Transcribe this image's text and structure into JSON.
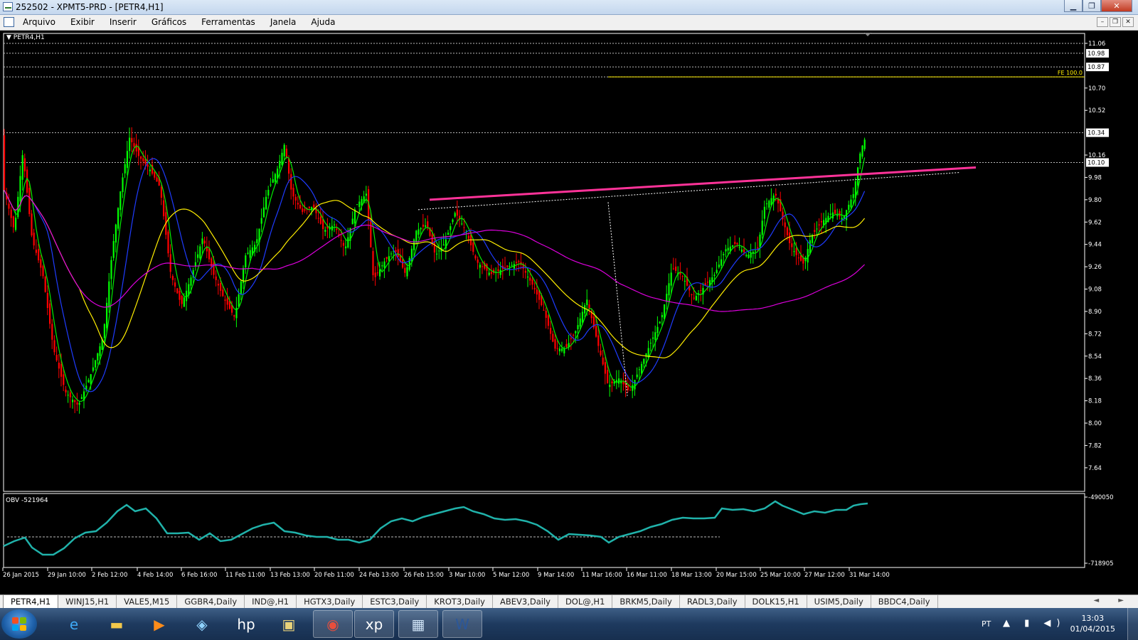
{
  "window": {
    "title": "252502 - XPMT5-PRD - [PETR4,H1]"
  },
  "window_buttons": {
    "minimize": "▁",
    "maximize": "❐",
    "close": "✕"
  },
  "mdi_buttons": {
    "minimize": "–",
    "restore": "❐",
    "close": "✕"
  },
  "menu": [
    "Arquivo",
    "Exibir",
    "Inserir",
    "Gráficos",
    "Ferramentas",
    "Janela",
    "Ajuda"
  ],
  "chart": {
    "label": "PETR4,H1",
    "fe_label": "FE 100.0",
    "obv_label": "OBV -521964",
    "price_ticks": [
      "11.06",
      "10.70",
      "10.52",
      "10.16",
      "9.98",
      "9.80",
      "9.62",
      "9.44",
      "9.26",
      "9.08",
      "8.90",
      "8.72",
      "8.54",
      "8.36",
      "8.18",
      "8.00",
      "7.82",
      "7.64"
    ],
    "price_levels": [
      "10.98",
      "10.87",
      "10.34",
      "10.10"
    ],
    "obv_ticks": [
      "-490050",
      "-718905"
    ],
    "time_labels": [
      "26 Jan 2015",
      "29 Jan 10:00",
      "2 Feb 12:00",
      "4 Feb 14:00",
      "6 Feb 16:00",
      "11 Feb 11:00",
      "13 Feb 13:00",
      "20 Feb 11:00",
      "24 Feb 13:00",
      "26 Feb 15:00",
      "3 Mar 10:00",
      "5 Mar 12:00",
      "9 Mar 14:00",
      "11 Mar 16:00",
      "16 Mar 11:00",
      "18 Mar 13:00",
      "20 Mar 15:00",
      "25 Mar 10:00",
      "27 Mar 12:00",
      "31 Mar 14:00"
    ],
    "colors": {
      "bull": "#00ff00",
      "bear": "#ff0000",
      "trend": "#ff3399",
      "ma_blue": "#1f3cff",
      "ma_green": "#00ee00",
      "ma_yellow": "#ffee00",
      "ma_magenta": "#dd00dd",
      "obv": "#20b2aa"
    }
  },
  "tabs": [
    "PETR4,H1",
    "WINJ15,H1",
    "VALE5,M15",
    "GGBR4,Daily",
    "IND@,H1",
    "HGTX3,Daily",
    "ESTC3,Daily",
    "KROT3,Daily",
    "ABEV3,Daily",
    "DOL@,H1",
    "BRKM5,Daily",
    "RADL3,Daily",
    "DOLK15,H1",
    "USIM5,Daily",
    "BBDC4,Daily"
  ],
  "tab_arrows": "◄ ►",
  "taskbar": {
    "icons": [
      {
        "name": "ie-icon",
        "glyph": "e"
      },
      {
        "name": "explorer-icon",
        "glyph": "▬"
      },
      {
        "name": "media-player-icon",
        "glyph": "▶"
      },
      {
        "name": "network-icon",
        "glyph": "◈"
      },
      {
        "name": "hp-icon",
        "glyph": "hp"
      },
      {
        "name": "archive-icon",
        "glyph": "▣"
      },
      {
        "name": "chrome-icon",
        "glyph": "◉"
      },
      {
        "name": "xp-icon",
        "glyph": "xp"
      },
      {
        "name": "metatrader-icon",
        "glyph": "▦"
      },
      {
        "name": "word-icon",
        "glyph": "W"
      }
    ],
    "language": "PT",
    "tray_icons": "▲ ▮ ◀)",
    "time": "13:03",
    "date": "01/04/2015"
  }
}
